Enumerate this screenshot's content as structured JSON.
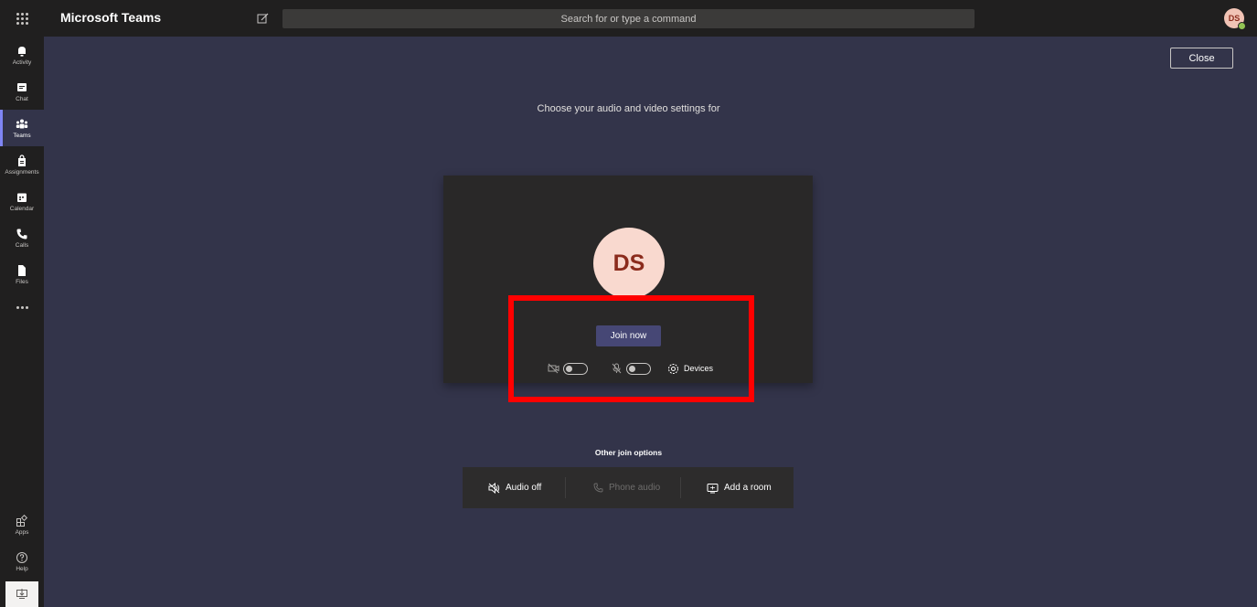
{
  "app": {
    "title": "Microsoft Teams"
  },
  "search": {
    "placeholder": "Search for or type a command"
  },
  "user": {
    "initials": "DS",
    "status_color": "#92c353"
  },
  "rail": {
    "items": [
      {
        "label": "Activity",
        "icon": "bell-icon"
      },
      {
        "label": "Chat",
        "icon": "chat-icon"
      },
      {
        "label": "Teams",
        "icon": "teams-icon",
        "active": true
      },
      {
        "label": "Assignments",
        "icon": "assignments-icon"
      },
      {
        "label": "Calendar",
        "icon": "calendar-icon"
      },
      {
        "label": "Calls",
        "icon": "phone-icon"
      },
      {
        "label": "Files",
        "icon": "file-icon"
      }
    ],
    "bottom": [
      {
        "label": "Apps",
        "icon": "apps-icon"
      },
      {
        "label": "Help",
        "icon": "help-icon"
      }
    ]
  },
  "prejoin": {
    "close_label": "Close",
    "heading": "Choose your audio and video settings for",
    "avatar_initials": "DS",
    "join_label": "Join now",
    "camera_on": false,
    "mic_on": false,
    "devices_label": "Devices"
  },
  "other_options": {
    "title": "Other join options",
    "audio_off": "Audio off",
    "phone_audio": "Phone audio",
    "add_room": "Add a room"
  },
  "colors": {
    "accent": "#464775",
    "background": "#33344a",
    "highlight": "#ff0000"
  }
}
